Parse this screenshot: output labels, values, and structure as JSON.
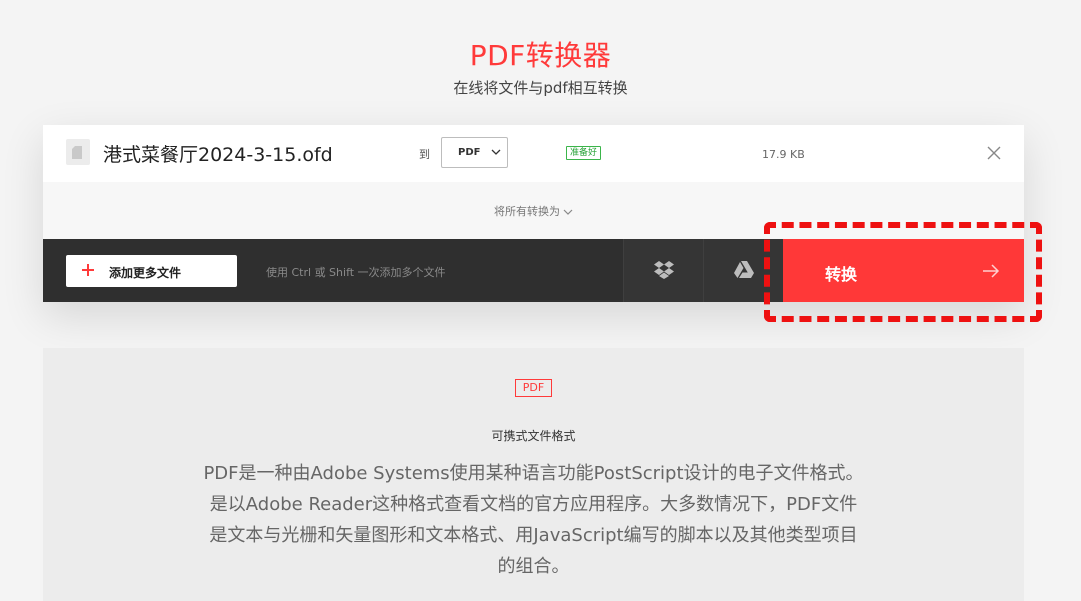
{
  "header": {
    "title": "PDF转换器",
    "subtitle": "在线将文件与pdf相互转换"
  },
  "file": {
    "name": "港式菜餐厅2024-3-15.ofd",
    "to_label": "到",
    "format": "PDF",
    "status": "准备好",
    "size": "17.9 KB"
  },
  "convert_all": {
    "label": "将所有转换为"
  },
  "toolbar": {
    "add_label": "添加更多文件",
    "hint": "使用 Ctrl 或 Shift 一次添加多个文件",
    "convert_label": "转换"
  },
  "info": {
    "tag": "PDF",
    "title": "可携式文件格式",
    "description": "PDF是一种由Adobe Systems使用某种语言功能PostScript设计的电子文件格式。是以Adobe Reader这种格式查看文档的官方应用程序。大多数情况下，PDF文件是文本与光栅和矢量图形和文本格式、用JavaScript编写的脚本以及其他类型项目的组合。"
  },
  "colors": {
    "accent": "#ff3a3a",
    "toolbar": "#2f2f2f",
    "ready": "#3bb54a",
    "highlight": "#ee1111"
  }
}
